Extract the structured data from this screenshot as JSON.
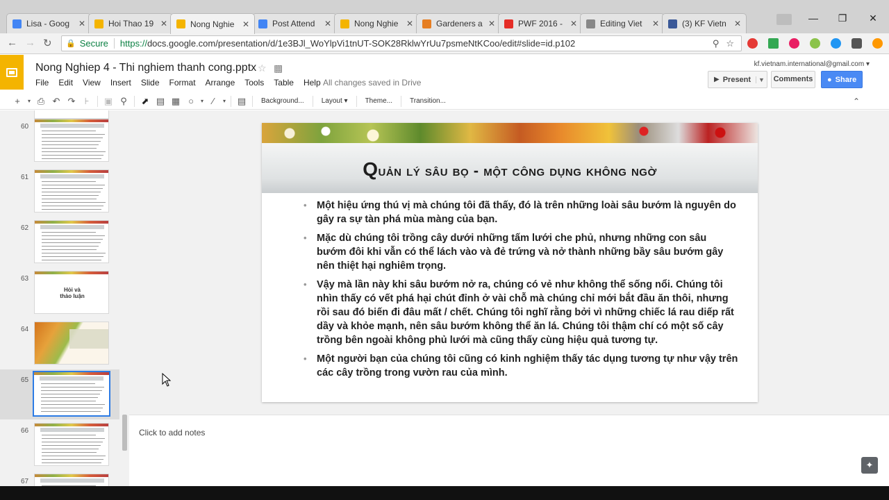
{
  "browser": {
    "tabs": [
      {
        "label": "Lisa - Goog",
        "color": "#4285f4"
      },
      {
        "label": "Hoi Thao 19",
        "color": "#f4b400"
      },
      {
        "label": "Nong Nghie",
        "color": "#f4b400",
        "active": true
      },
      {
        "label": "Post Attend",
        "color": "#4285f4"
      },
      {
        "label": "Nong Nghie",
        "color": "#f4b400"
      },
      {
        "label": "Gardeners a",
        "color": "#e67e22"
      },
      {
        "label": "PWF 2016 -",
        "color": "#e52d27"
      },
      {
        "label": "Editing Viet",
        "color": "#888888"
      },
      {
        "label": "(3) KF Vietn",
        "color": "#3b5998"
      }
    ],
    "secure_label": "Secure",
    "url_prefix": "https://",
    "url_main": "docs.google.com",
    "url_tail": "/presentation/d/1e3BJl_WoYlpVi1tnUT-SOK28RklwYrUu7psmeNtKCoo/edit#slide=id.p102"
  },
  "app": {
    "doc_title": "Nong Nghiep 4 - Thi nghiem thanh cong.pptx",
    "menu": [
      "File",
      "Edit",
      "View",
      "Insert",
      "Slide",
      "Format",
      "Arrange",
      "Tools",
      "Table",
      "Help"
    ],
    "saved_status": "All changes saved in Drive",
    "account": "kf.vietnam.international@gmail.com",
    "present_label": "Present",
    "comments_label": "Comments",
    "share_label": "Share"
  },
  "toolbar": {
    "background_label": "Background...",
    "layout_label": "Layout",
    "theme_label": "Theme...",
    "transition_label": "Transition..."
  },
  "filmstrip": {
    "slides": [
      {
        "num": "60",
        "text": ""
      },
      {
        "num": "61",
        "text": ""
      },
      {
        "num": "62",
        "text": ""
      },
      {
        "num": "63",
        "text": "Hỏi và\nthảo luận"
      },
      {
        "num": "64",
        "text": ""
      },
      {
        "num": "65",
        "text": "",
        "selected": true
      },
      {
        "num": "66",
        "text": ""
      },
      {
        "num": "67",
        "text": ""
      }
    ]
  },
  "slide": {
    "title_first": "Q",
    "title_rest": "uản lý sâu bọ - một công dụng không ngờ",
    "bullets": [
      "Một hiệu ứng thú vị mà chúng tôi đã thấy, đó là trên những loài sâu bướm là nguyên do gây ra sự tàn phá mùa màng của bạn.",
      "Mặc dù chúng tôi trồng cây dưới những tấm lưới che phủ, nhưng những con sâu bướm đôi khi vẫn có thể lách vào và đẻ trứng và nở thành những bầy sâu bướm gây nên thiệt hại nghiêm trọng.",
      "Vậy mà lần này khi sâu bướm nở ra, chúng có vẻ như không thể sống nổi. Chúng tôi nhìn thấy có vết phá hại chút đỉnh ở vài chỗ mà chúng chỉ mới bắt đầu ăn thôi, nhưng rồi sau đó biến đi đâu mất / chết. Chúng tôi nghĩ rằng bởi vì những chiếc lá rau diếp rất dầy và khỏe mạnh, nên sâu bướm không thể ăn lá. Chúng tôi thậm chí có một số cây trồng bên ngoài không phủ lưới mà cũng thấy cùng hiệu quả tương tự.",
      "Một người bạn của chúng tôi cũng có kinh nghiệm thấy tác dụng tương tự như vậy trên các cây trồng trong vườn rau của mình."
    ]
  },
  "notes": {
    "placeholder": "Click to add notes"
  }
}
